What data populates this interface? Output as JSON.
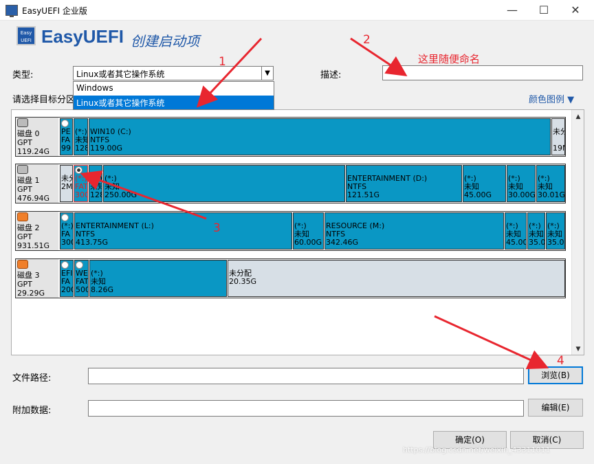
{
  "window": {
    "title": "EasyUEFI 企业版",
    "minimize": "—",
    "maximize": "☐",
    "close": "✕"
  },
  "header": {
    "logo_text": "Easy UEFI",
    "brand": "EasyUEFI",
    "subtitle": "创建启动项"
  },
  "form": {
    "type_label": "类型:",
    "type_value": "Linux或者其它操作系统",
    "type_options": [
      "Windows",
      "Linux或者其它操作系统"
    ],
    "desc_label": "描述:",
    "desc_value": "",
    "select_partition_label": "请选择目标分区",
    "color_legend": "颜色图例 ▼"
  },
  "disks": [
    {
      "name": "磁盘 0",
      "style": "GPT",
      "size": "119.24G",
      "parts": [
        {
          "l1": "PE",
          "l2": "FA",
          "l3": "99"
        },
        {
          "l1": "(*:)",
          "l2": "未知",
          "l3": "128"
        },
        {
          "l1": "WIN10 (C:)",
          "l2": "NTFS",
          "l3": "119.00G"
        },
        {
          "l1": "未分",
          "l2": "",
          "l3": "19M"
        }
      ]
    },
    {
      "name": "磁盘 1",
      "style": "GPT",
      "size": "476.94G",
      "parts": [
        {
          "l1": "未分",
          "l2": "2M",
          "l3": ""
        },
        {
          "l1": "(*:)",
          "l2": "FAT",
          "l3": "300"
        },
        {
          "l1": "(*:)",
          "l2": "未知",
          "l3": "128"
        },
        {
          "l1": "(*:)",
          "l2": "未知",
          "l3": "250.00G"
        },
        {
          "l1": "ENTERTAINMENT (D:)",
          "l2": "NTFS",
          "l3": "121.51G"
        },
        {
          "l1": "(*:)",
          "l2": "未知",
          "l3": "45.00G"
        },
        {
          "l1": "(*:)",
          "l2": "未知",
          "l3": "30.00G"
        },
        {
          "l1": "(*:)",
          "l2": "未知",
          "l3": "30.01G"
        }
      ]
    },
    {
      "name": "磁盘 2",
      "style": "GPT",
      "size": "931.51G",
      "parts": [
        {
          "l1": "(*:)",
          "l2": "FA",
          "l3": "300"
        },
        {
          "l1": "ENTERTAINMENT (L:)",
          "l2": "NTFS",
          "l3": "413.75G"
        },
        {
          "l1": "(*:)",
          "l2": "未知",
          "l3": "60.00G"
        },
        {
          "l1": "RESOURCE (M:)",
          "l2": "NTFS",
          "l3": "342.46G"
        },
        {
          "l1": "(*:)",
          "l2": "未知",
          "l3": "45.00"
        },
        {
          "l1": "(*:)",
          "l2": "未知",
          "l3": "35.0"
        },
        {
          "l1": "(*:)",
          "l2": "未知",
          "l3": "35.0"
        }
      ]
    },
    {
      "name": "磁盘 3",
      "style": "GPT",
      "size": "29.29G",
      "parts": [
        {
          "l1": "EFI",
          "l2": "FA",
          "l3": "200"
        },
        {
          "l1": "WE",
          "l2": "FAT",
          "l3": "500"
        },
        {
          "l1": "(*:)",
          "l2": "未知",
          "l3": "8.26G"
        },
        {
          "l1": "未分配",
          "l2": "20.35G",
          "l3": ""
        }
      ]
    }
  ],
  "bottom": {
    "path_label": "文件路径:",
    "path_value": "",
    "browse_button": "浏览(B)",
    "extra_label": "附加数据:",
    "extra_value": "",
    "edit_button": "编辑(E)",
    "ok_button": "确定(O)",
    "cancel_button": "取消(C)"
  },
  "annotations": {
    "n1": "1",
    "n2": "2",
    "n3": "3",
    "n4": "4",
    "note": "这里随便命名"
  },
  "watermark": "https://blog.csdn.net/weixin_43311011",
  "colors": {
    "partition": "#0a97c4",
    "unallocated": "#d7dfe6",
    "annotation": "#e8262f",
    "brand": "#1f58a8"
  }
}
